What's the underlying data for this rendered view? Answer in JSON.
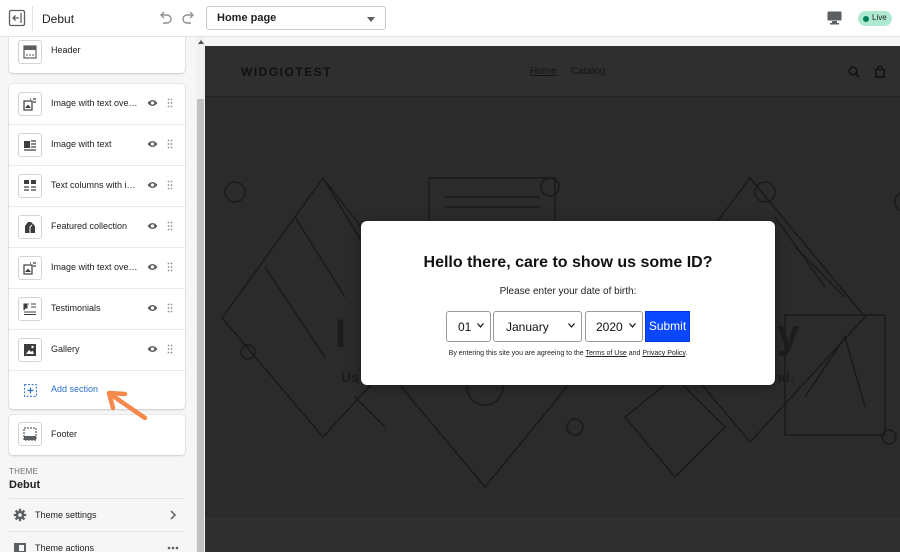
{
  "topbar": {
    "theme_name": "Debut",
    "page_select_value": "Home page",
    "live_label": "Live"
  },
  "sidebar": {
    "header_section": {
      "label": "Header",
      "icon": "header-layout-icon"
    },
    "sections": [
      {
        "label": "Image with text overlay",
        "icon": "image-text-icon"
      },
      {
        "label": "Image with text",
        "icon": "image-with-text-icon"
      },
      {
        "label": "Text columns with images",
        "icon": "columns-icon"
      },
      {
        "label": "Featured collection",
        "icon": "collection-tag-icon"
      },
      {
        "label": "Image with text overlay",
        "icon": "image-text-icon"
      },
      {
        "label": "Testimonials",
        "icon": "quote-icon"
      },
      {
        "label": "Gallery",
        "icon": "gallery-icon"
      }
    ],
    "add_section_label": "Add section",
    "footer_section": {
      "label": "Footer",
      "icon": "footer-layout-icon"
    },
    "theme_caption": "THEME",
    "theme_title": "Debut",
    "theme_settings_label": "Theme settings",
    "theme_actions_label": "Theme actions"
  },
  "preview": {
    "store_logo": "WIDGIOTEST",
    "nav": [
      "Home",
      "Catalog"
    ]
  },
  "modal": {
    "title": "Hello there, care to show us some ID?",
    "subtitle": "Please enter your date of birth:",
    "day_value": "01",
    "month_value": "January",
    "year_value": "2020",
    "submit_label": "Submit",
    "fine_prefix": "By entering this site you are agreeing to the ",
    "terms_label": "Terms of Use",
    "fine_and": " and ",
    "privacy_label": "Privacy Policy",
    "fine_suffix": "."
  },
  "colors": {
    "accent_link": "#2c6ecb",
    "submit_button": "#0a47ff",
    "live_badge": "#aee9d1",
    "annotation_arrow": "#f4894b"
  }
}
